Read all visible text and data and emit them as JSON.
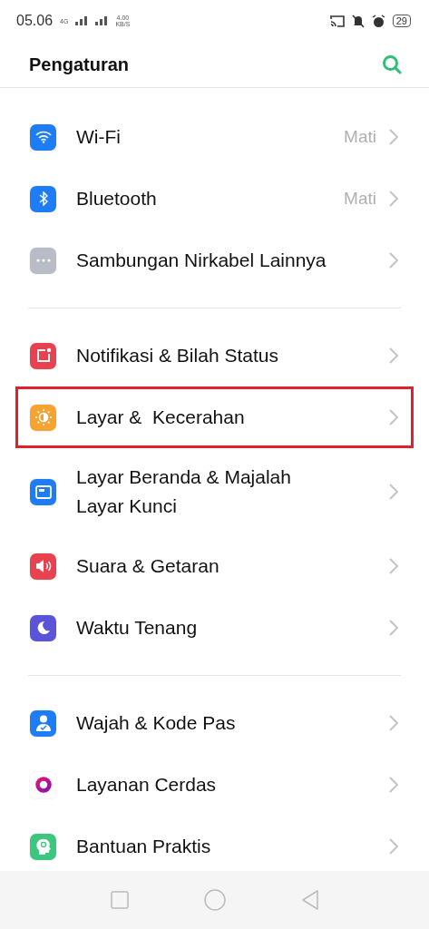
{
  "status_bar": {
    "time": "05.06",
    "network": "4G",
    "speed": "4.00",
    "speed_unit": "KB/S",
    "battery": "29"
  },
  "header": {
    "title": "Pengaturan"
  },
  "groups": [
    {
      "items": [
        {
          "kind": "wifi",
          "label": "Wi-Fi",
          "value": "Mati",
          "color": "#1e7cf5",
          "highlighted": false
        },
        {
          "kind": "bluetooth",
          "label": "Bluetooth",
          "value": "Mati",
          "color": "#1e7cf5",
          "highlighted": false
        },
        {
          "kind": "more",
          "label": "Sambungan Nirkabel Lainnya",
          "color": "#b8bcc6",
          "highlighted": false
        }
      ]
    },
    {
      "items": [
        {
          "kind": "notification",
          "label": "Notifikasi & Bilah Status",
          "color": "#e8414f",
          "highlighted": false
        },
        {
          "kind": "brightness",
          "label": "Layar &  Kecerahan",
          "color": "#f6a332",
          "highlighted": true
        },
        {
          "kind": "wallpaper",
          "label": "Layar Beranda & Majalah Layar Kunci",
          "color": "#1e7cf5",
          "highlighted": false
        },
        {
          "kind": "sound",
          "label": "Suara & Getaran",
          "color": "#e8414f",
          "highlighted": false
        },
        {
          "kind": "moon",
          "label": "Waktu Tenang",
          "color": "#5b54d9",
          "highlighted": false
        }
      ]
    },
    {
      "items": [
        {
          "kind": "face",
          "label": "Wajah & Kode Pas",
          "color": "#1e7cf5",
          "highlighted": false
        },
        {
          "kind": "smart",
          "label": "Layanan Cerdas",
          "color": "#ffffff",
          "highlighted": false
        },
        {
          "kind": "assist",
          "label": "Bantuan Praktis",
          "color": "#3cc67e",
          "highlighted": false
        }
      ]
    }
  ]
}
